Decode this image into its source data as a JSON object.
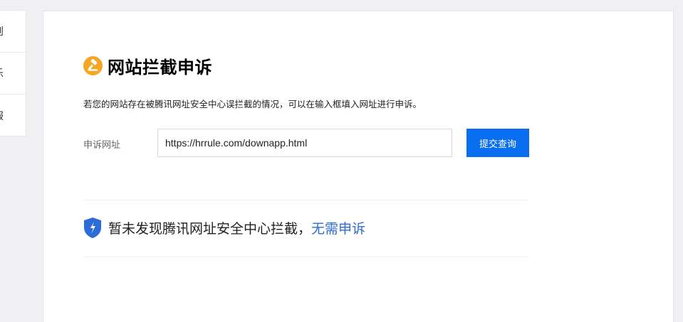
{
  "side_nav": {
    "items": [
      {
        "label": "则"
      },
      {
        "label": "乐"
      },
      {
        "label": "服"
      }
    ]
  },
  "page": {
    "title": "网站拦截申诉",
    "description": "若您的网站存在被腾讯网址安全中心误拦截的情况，可以在输入框填入网址进行申诉。"
  },
  "form": {
    "label": "申诉网址",
    "url_value": "https://hrrule.com/downapp.html",
    "submit_label": "提交查询"
  },
  "result": {
    "message": "暂未发现腾讯网址安全中心拦截，",
    "link_text": "无需申诉"
  },
  "colors": {
    "accent": "#0a6ef0",
    "title_icon": "#f5a623",
    "shield": "#2c6cd6",
    "link": "#2c6cd6"
  },
  "icons": {
    "title": "gavel-icon",
    "result": "shield-icon"
  }
}
